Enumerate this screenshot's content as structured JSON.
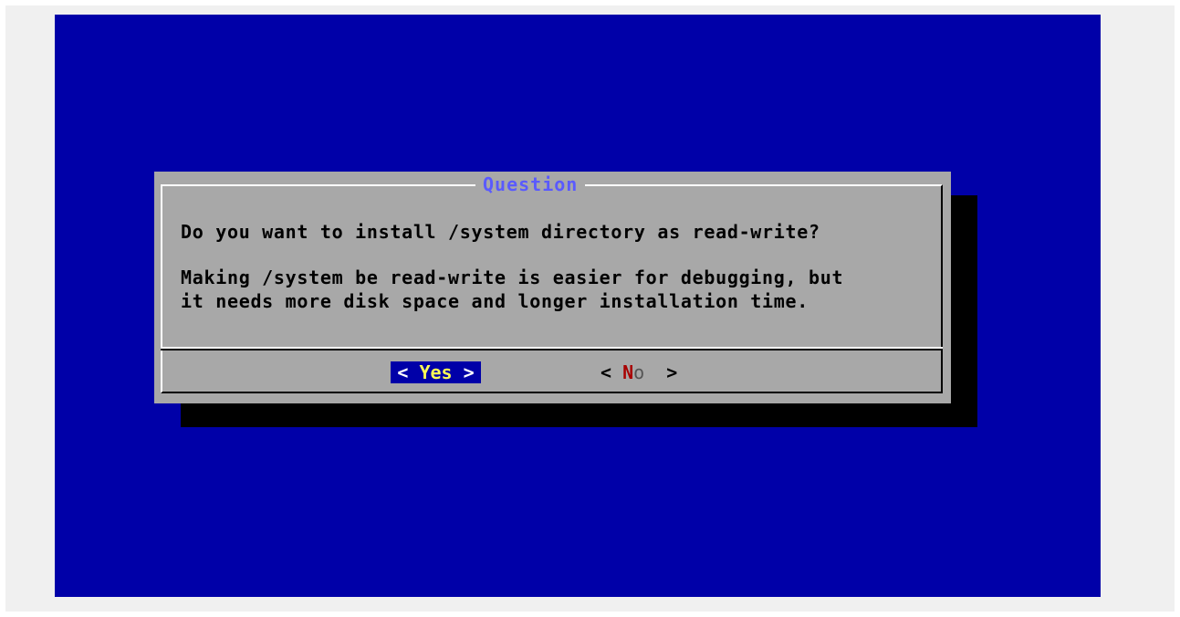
{
  "dialog": {
    "title": "Question",
    "question": "Do you want to install /system directory as read-write?",
    "description_line1": "Making /system be read-write is easier for debugging, but",
    "description_line2": "it needs more disk space and longer installation time."
  },
  "buttons": {
    "yes": {
      "left_bracket": "<",
      "label": "Yes",
      "right_bracket": ">"
    },
    "no": {
      "left_bracket": "<",
      "hotkey": "N",
      "rest": "o",
      "right_bracket": ">"
    }
  },
  "colors": {
    "screen_background": "#0000a8",
    "dialog_background": "#a8a8a8",
    "title_color": "#5a5aff",
    "selected_button_background": "#0000a8",
    "selected_button_text": "#ffff55",
    "hotkey_color": "#a80000",
    "shadow": "#000000"
  }
}
